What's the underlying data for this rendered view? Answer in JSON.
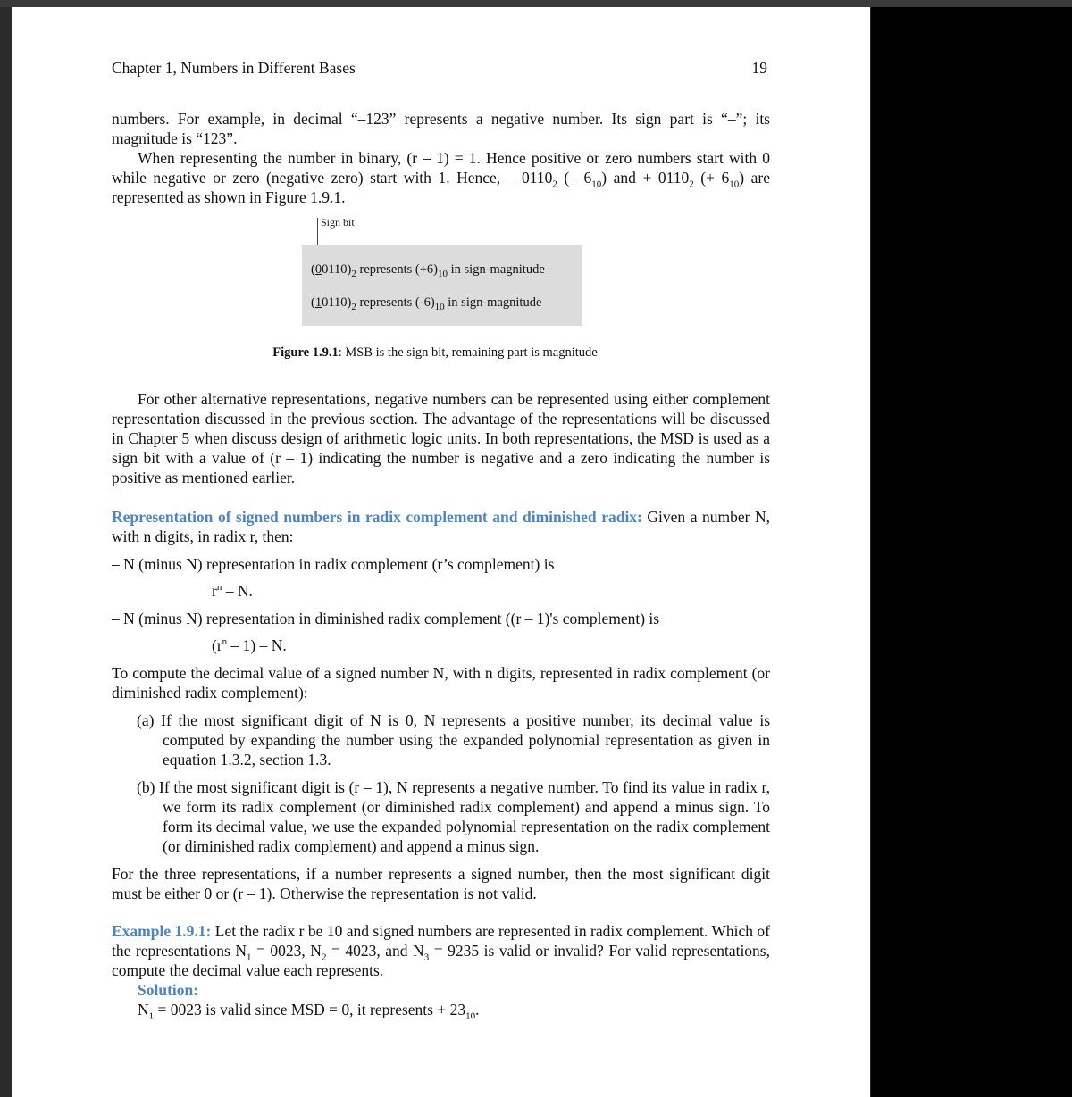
{
  "header": {
    "chapter": "Chapter 1, Numbers in Different Bases",
    "page_number": "19"
  },
  "intro": {
    "p1": "numbers. For example, in decimal “–123” represents a negative number. Its sign part is “–”; its magnitude is “123”.",
    "p2_a": "When representing the number in binary, (r – 1) = 1. Hence positive or zero numbers start with 0 while negative or zero (negative zero) start with 1. Hence, – 0110",
    "p2_sub1": "2",
    "p2_b": " (– 6",
    "p2_sub2": "10",
    "p2_c": ") and + 0110",
    "p2_sub3": "2",
    "p2_d": " (+ 6",
    "p2_sub4": "10",
    "p2_e": ")  are represented as shown in Figure 1.9.1."
  },
  "figure": {
    "sign_bit_label": "Sign bit",
    "line1_paren": "(",
    "line1_bit": "0",
    "line1_rest": "0110)",
    "line1_sub": "2",
    "line1_mid": " represents (+6)",
    "line1_sub2": "10",
    "line1_end": " in sign-magnitude",
    "line2_paren": "(",
    "line2_bit": "1",
    "line2_rest": "0110)",
    "line2_sub": "2",
    "line2_mid": " represents (-6)",
    "line2_sub2": "10",
    "line2_end": " in sign-magnitude",
    "caption_bold": "Figure 1.9.1",
    "caption_rest": ": MSB is the sign bit, remaining part is magnitude"
  },
  "alt_paragraph": "For other alternative representations, negative numbers can be represented using either complement representation discussed in the previous section. The advantage of the representations will be discussed in Chapter 5 when discuss design of arithmetic logic units.  In both representations, the MSD is used as a sign bit with a value of (r – 1) indicating the number is negative and a zero indicating the number is positive as mentioned earlier.",
  "signed_section": {
    "heading": "Representation of signed numbers in radix complement and diminished radix:",
    "heading_rest": " Given a number N, with n digits, in radix r, then:",
    "radix_line": "– N (minus N) representation in radix complement (r’s complement) is",
    "radix_eq_base": "r",
    "radix_eq_exp": "n",
    "radix_eq_rest": " – N.",
    "dim_line": "– N (minus N) representation in diminished radix complement ((r – 1)'s complement) is",
    "dim_eq_a": "(r",
    "dim_eq_exp": "n",
    "dim_eq_rest": " – 1) – N.",
    "compute_intro": "To compute the decimal value of a signed number N, with n digits, represented in radix complement (or diminished radix complement):",
    "item_a": "(a) If the most significant digit of N is 0, N represents a positive number, its decimal value is computed by expanding the number using the expanded polynomial representation as given in equation 1.3.2, section 1.3.",
    "item_b": "(b) If the most significant digit is (r – 1), N represents a negative number. To find its value in radix r, we form its radix complement (or diminished radix complement) and append a minus sign.  To form its decimal value, we use the expanded polynomial representation on the radix complement (or diminished radix complement) and append a minus sign.",
    "three_reps": "For the three representations, if a number represents a signed number, then the most significant digit must be either 0 or (r – 1).  Otherwise the representation is not valid."
  },
  "example": {
    "label": "Example 1.9.1:",
    "t1": " Let the radix r be 10 and signed numbers are represented in radix complement. Which of the representations N",
    "s1": "1",
    "t2": " = 0023, N",
    "s2": "2",
    "t3": " = 4023, and N",
    "s3": "3",
    "t4": " = 9235 is valid or invalid?  For valid representations, compute the decimal value each represents.",
    "solution_label": "Solution:",
    "sol_a": "N",
    "sol_s1": "1",
    "sol_b": " = 0023 is valid since MSD = 0, it represents + 23",
    "sol_s2": "10",
    "sol_c": "."
  }
}
